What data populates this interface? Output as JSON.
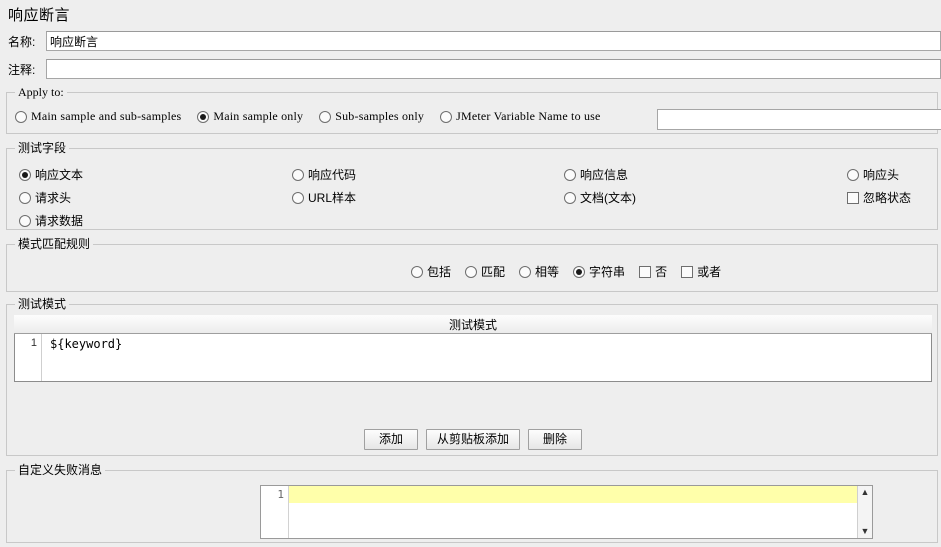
{
  "page": {
    "title": "响应断言"
  },
  "fields": {
    "name_label": "名称:",
    "name_value": "响应断言",
    "comment_label": "注释:",
    "comment_value": ""
  },
  "apply_to": {
    "group_title": "Apply to:",
    "options": [
      {
        "label": "Main sample and sub-samples",
        "selected": false
      },
      {
        "label": "Main sample only",
        "selected": true
      },
      {
        "label": "Sub-samples only",
        "selected": false
      },
      {
        "label": "JMeter Variable Name to use",
        "selected": false
      }
    ],
    "variable_value": "",
    "variable_placeholder": ""
  },
  "test_field": {
    "group_title": "测试字段",
    "columns": [
      [
        {
          "label": "响应文本",
          "type": "radio",
          "selected": true
        },
        {
          "label": "请求头",
          "type": "radio",
          "selected": false
        },
        {
          "label": "请求数据",
          "type": "radio",
          "selected": false
        }
      ],
      [
        {
          "label": "响应代码",
          "type": "radio",
          "selected": false
        },
        {
          "label": "URL样本",
          "type": "radio",
          "selected": false
        }
      ],
      [
        {
          "label": "响应信息",
          "type": "radio",
          "selected": false
        },
        {
          "label": "文档(文本)",
          "type": "radio",
          "selected": false
        }
      ],
      [
        {
          "label": "响应头",
          "type": "radio",
          "selected": false
        },
        {
          "label": "忽略状态",
          "type": "checkbox",
          "selected": false
        }
      ]
    ]
  },
  "pattern_rules": {
    "group_title": "模式匹配规则",
    "options": [
      {
        "label": "包括",
        "type": "radio",
        "selected": false
      },
      {
        "label": "匹配",
        "type": "radio",
        "selected": false
      },
      {
        "label": "相等",
        "type": "radio",
        "selected": false
      },
      {
        "label": "字符串",
        "type": "radio",
        "selected": true
      },
      {
        "label": "否",
        "type": "checkbox",
        "selected": false
      },
      {
        "label": "或者",
        "type": "checkbox",
        "selected": false
      }
    ]
  },
  "test_pattern": {
    "group_title": "测试模式",
    "column_header": "测试模式",
    "rows": [
      {
        "index": "1",
        "value": "${keyword}"
      }
    ],
    "buttons": [
      {
        "label": "添加"
      },
      {
        "label": "从剪贴板添加"
      },
      {
        "label": "删除"
      }
    ]
  },
  "custom_message": {
    "group_title": "自定义失败消息",
    "line_number": "1",
    "value": "",
    "scroll_up_icon": "▲",
    "scroll_down_icon": "▼"
  }
}
